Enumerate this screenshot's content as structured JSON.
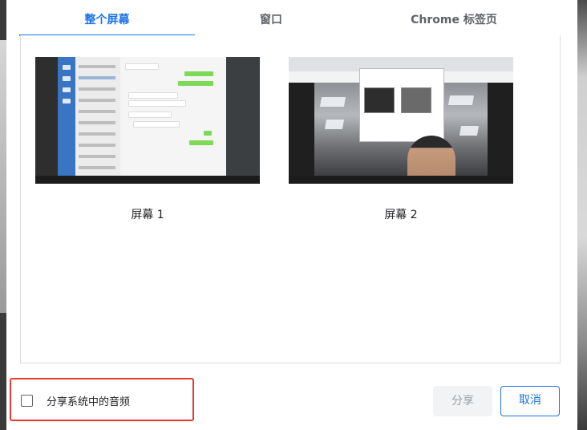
{
  "tabs": [
    {
      "label": "整个屏幕",
      "active": true
    },
    {
      "label": "窗口",
      "active": false
    },
    {
      "label": "Chrome 标签页",
      "active": false
    }
  ],
  "sources": [
    {
      "label": "屏幕 1",
      "thumbnail": "chat-app-desktop"
    },
    {
      "label": "屏幕 2",
      "thumbnail": "browser-with-camera-view"
    }
  ],
  "footer": {
    "audio_checkbox_label": "分享系统中的音频",
    "audio_checked": false,
    "share_label": "分享",
    "cancel_label": "取消"
  },
  "colors": {
    "accent": "#1a73e8",
    "highlight": "#e53935",
    "disabled_text": "#9aa0a6"
  }
}
